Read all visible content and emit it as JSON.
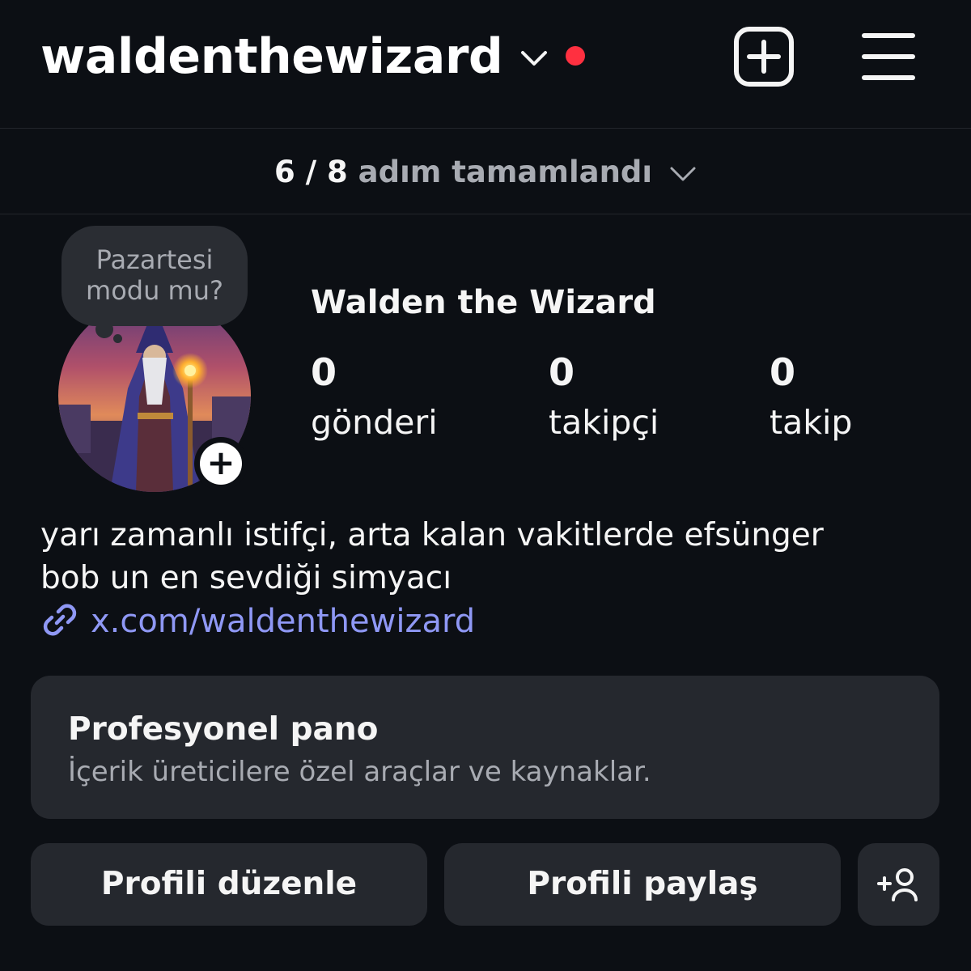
{
  "header": {
    "username": "waldenthewizard",
    "notification_dot_color": "#ff3040",
    "icons": [
      "chevron-down-icon",
      "new-post-icon",
      "menu-icon"
    ]
  },
  "progress": {
    "count": "6 / 8",
    "label": "adım tamamlandı",
    "completed": 6,
    "total": 8
  },
  "profile": {
    "note": "Pazartesi modu mu?",
    "display_name": "Walden the Wizard",
    "stats": [
      {
        "value": "0",
        "label": "gönderi"
      },
      {
        "value": "0",
        "label": "takipçi"
      },
      {
        "value": "0",
        "label": "takip"
      }
    ],
    "bio_line1": "yarı zamanlı istifçi, arta kalan vakitlerde efsünger",
    "bio_line2": "bob un en sevdiği simyacı",
    "link": "x.com/waldenthewizard",
    "link_color": "#8f98f5"
  },
  "pro_dashboard": {
    "title": "Profesyonel pano",
    "subtitle": "İçerik üreticilere özel araçlar ve kaynaklar."
  },
  "actions": {
    "edit_label": "Profili düzenle",
    "share_label": "Profili paylaş"
  }
}
